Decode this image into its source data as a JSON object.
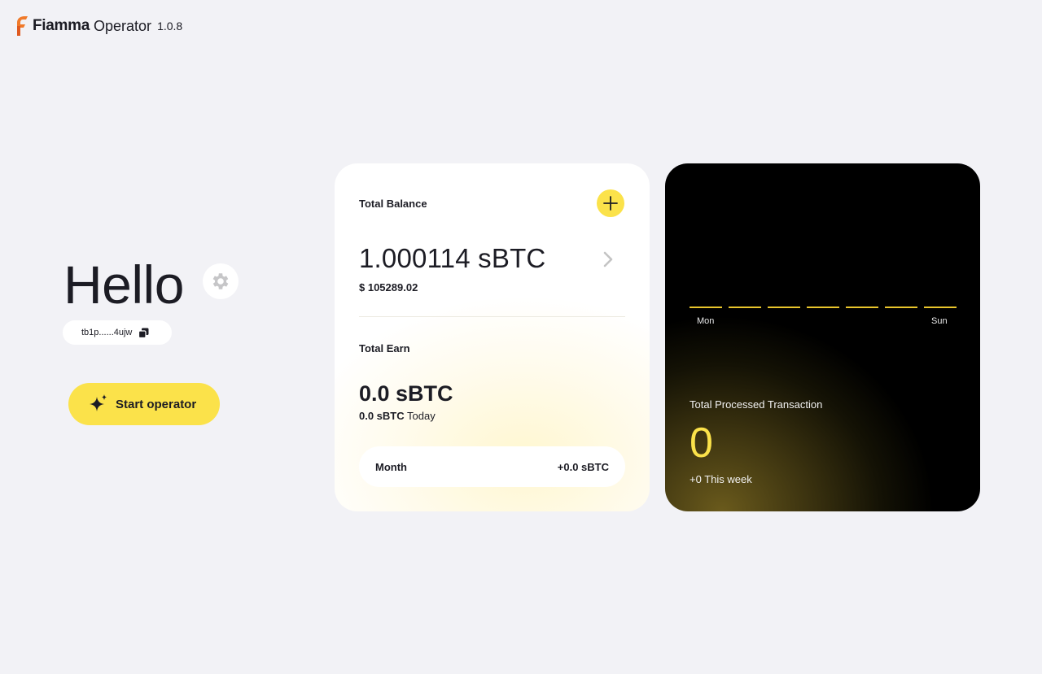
{
  "header": {
    "brand_name": "Fiamma",
    "product": "Operator",
    "version": "1.0.8",
    "logo_color": "#f07a2a"
  },
  "greeting": {
    "text": "Hello",
    "settings_icon": "gear-icon"
  },
  "wallet": {
    "address_short": "tb1p......4ujw",
    "copy_icon": "copy-icon"
  },
  "actions": {
    "start_label": "Start operator",
    "start_icon": "sparkle-icon",
    "accent": "#fbe24a"
  },
  "balance_card": {
    "total_balance_label": "Total Balance",
    "add_icon": "plus-icon",
    "balance": "1.000114 sBTC",
    "usd_value": "$ 105289.02",
    "total_earn_label": "Total Earn",
    "earn_value": "0.0 sBTC",
    "earn_today_value": "0.0 sBTC",
    "earn_today_label": "Today",
    "month_label": "Month",
    "month_value": "+0.0 sBTC"
  },
  "transactions_card": {
    "day_start": "Mon",
    "day_end": "Sun",
    "days": [
      0,
      0,
      0,
      0,
      0,
      0,
      0
    ],
    "title": "Total Processed Transaction",
    "count": "0",
    "week_change": "+0 This week"
  }
}
